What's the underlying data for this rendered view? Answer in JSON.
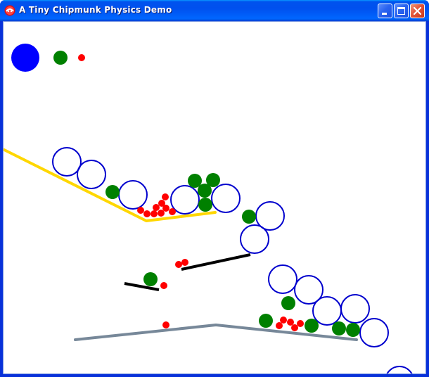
{
  "window": {
    "title": "A Tiny Chipmunk Physics Demo",
    "app_icon": "chipmunk-app-icon",
    "controls": {
      "minimize_icon": "minimize-icon",
      "maximize_icon": "maximize-icon",
      "close_icon": "close-icon"
    }
  },
  "colors": {
    "titlebar": "#0054e3",
    "window_border": "#0831d9",
    "background": "#ffffff",
    "yellow_segment": "#ffd700",
    "black_segment": "#000000",
    "gray_segment": "#778899",
    "blue_ball": "#0000ff",
    "hollow_ball_outline": "#0000cd",
    "green_ball": "#008000",
    "red_ball": "#ff0000"
  }
}
